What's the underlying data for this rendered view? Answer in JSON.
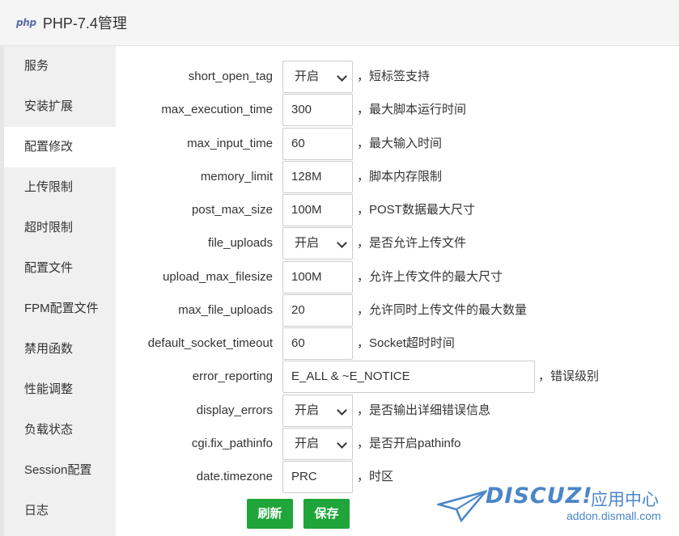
{
  "window": {
    "logo_text": "php",
    "title": "PHP-7.4管理"
  },
  "sidebar": {
    "items": [
      {
        "label": "服务",
        "active": false
      },
      {
        "label": "安装扩展",
        "active": false
      },
      {
        "label": "配置修改",
        "active": true
      },
      {
        "label": "上传限制",
        "active": false
      },
      {
        "label": "超时限制",
        "active": false
      },
      {
        "label": "配置文件",
        "active": false
      },
      {
        "label": "FPM配置文件",
        "active": false
      },
      {
        "label": "禁用函数",
        "active": false
      },
      {
        "label": "性能调整",
        "active": false
      },
      {
        "label": "负载状态",
        "active": false
      },
      {
        "label": "Session配置",
        "active": false
      },
      {
        "label": "日志",
        "active": false
      }
    ]
  },
  "settings": [
    {
      "name": "short_open_tag",
      "type": "select",
      "value": "开启",
      "desc": "，短标签支持"
    },
    {
      "name": "max_execution_time",
      "type": "input",
      "value": "300",
      "desc": "，最大脚本运行时间"
    },
    {
      "name": "max_input_time",
      "type": "input",
      "value": "60",
      "desc": "，最大输入时间"
    },
    {
      "name": "memory_limit",
      "type": "input",
      "value": "128M",
      "desc": "，脚本内存限制"
    },
    {
      "name": "post_max_size",
      "type": "input",
      "value": "100M",
      "desc": "，POST数据最大尺寸"
    },
    {
      "name": "file_uploads",
      "type": "select",
      "value": "开启",
      "desc": "，是否允许上传文件"
    },
    {
      "name": "upload_max_filesize",
      "type": "input",
      "value": "100M",
      "desc": "，允许上传文件的最大尺寸"
    },
    {
      "name": "max_file_uploads",
      "type": "input",
      "value": "20",
      "desc": "，允许同时上传文件的最大数量"
    },
    {
      "name": "default_socket_timeout",
      "type": "input",
      "value": "60",
      "desc": "，Socket超时时间"
    },
    {
      "name": "error_reporting",
      "type": "input-wide",
      "value": "E_ALL & ~E_NOTICE",
      "desc": "，错误级别"
    },
    {
      "name": "display_errors",
      "type": "select",
      "value": "开启",
      "desc": "，是否输出详细错误信息"
    },
    {
      "name": "cgi.fix_pathinfo",
      "type": "select",
      "value": "开启",
      "desc": "，是否开启pathinfo"
    },
    {
      "name": "date.timezone",
      "type": "input",
      "value": "PRC",
      "desc": "，时区"
    }
  ],
  "buttons": {
    "refresh": "刷新",
    "save": "保存"
  },
  "watermark": {
    "brand": "DISCUZ!",
    "cn": "应用中心",
    "url": "addon.dismall.com"
  },
  "colors": {
    "accent": "#20a53a",
    "watermark": "#4a86c8"
  }
}
